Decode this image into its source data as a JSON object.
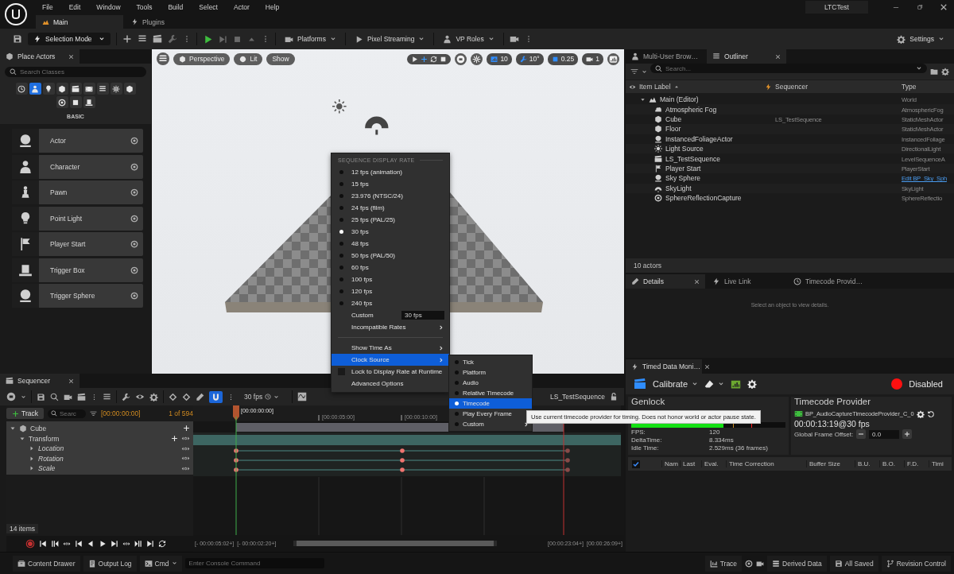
{
  "window": {
    "title": "LTCTest",
    "menu": [
      "File",
      "Edit",
      "Window",
      "Tools",
      "Build",
      "Select",
      "Actor",
      "Help"
    ],
    "tabs": [
      {
        "label": "Main",
        "selected": true
      },
      {
        "label": "Plugins",
        "selected": false
      }
    ]
  },
  "toolbar": {
    "mode": "Selection Mode",
    "dropdowns": [
      "Platforms",
      "Pixel Streaming",
      "VP Roles"
    ],
    "settings": "Settings"
  },
  "place_actors": {
    "title": "Place Actors",
    "search_placeholder": "Search Classes",
    "category_tabs": [
      {
        "selected": false
      },
      {
        "selected": true
      },
      {
        "selected": false
      },
      {
        "selected": false
      },
      {
        "selected": false
      },
      {
        "selected": false
      },
      {
        "selected": false
      },
      {
        "selected": false
      },
      {
        "selected": false
      },
      {
        "selected": false
      },
      {
        "selected": false
      },
      {
        "selected": false
      }
    ],
    "category": "BASIC",
    "items": [
      "Actor",
      "Character",
      "Pawn",
      "Point Light",
      "Player Start",
      "Trigger Box",
      "Trigger Sphere"
    ]
  },
  "viewport": {
    "buttons": [
      "Perspective",
      "Lit",
      "Show"
    ],
    "grid_snap": "10",
    "rotation_snap": "10°",
    "scale_snap": "0.25",
    "camera_speed": "1"
  },
  "display_rate_menu": {
    "header": "SEQUENCE DISPLAY RATE",
    "rates": [
      {
        "label": "12 fps (animation)",
        "selected": false
      },
      {
        "label": "15 fps",
        "selected": false
      },
      {
        "label": "23.976 (NTSC/24)",
        "selected": false
      },
      {
        "label": "24 fps (film)",
        "selected": false
      },
      {
        "label": "25 fps (PAL/25)",
        "selected": false
      },
      {
        "label": "30 fps",
        "selected": true
      },
      {
        "label": "48 fps",
        "selected": false
      },
      {
        "label": "50 fps (PAL/50)",
        "selected": false
      },
      {
        "label": "60 fps",
        "selected": false
      },
      {
        "label": "100 fps",
        "selected": false
      },
      {
        "label": "120 fps",
        "selected": false
      },
      {
        "label": "240 fps",
        "selected": false
      }
    ],
    "custom": {
      "label": "Custom",
      "value": "30 fps"
    },
    "incompatible": {
      "label": "Incompatible Rates",
      "highlighted": false
    },
    "options": [
      {
        "label": "Show Time As",
        "kind": "submenu",
        "highlighted": false
      },
      {
        "label": "Clock Source",
        "kind": "submenu",
        "highlighted": true
      },
      {
        "label": "Lock to Display Rate at Runtime",
        "kind": "checkbox",
        "checked": false,
        "highlighted": false
      },
      {
        "label": "Advanced Options",
        "kind": "plain",
        "highlighted": false
      }
    ]
  },
  "clock_source_menu": {
    "items": [
      {
        "label": "Tick",
        "selected": false,
        "submenu": false
      },
      {
        "label": "Platform",
        "selected": false,
        "submenu": false
      },
      {
        "label": "Audio",
        "selected": false,
        "submenu": false
      },
      {
        "label": "Relative Timecode",
        "selected": false,
        "submenu": false
      },
      {
        "label": "Timecode",
        "selected": true,
        "submenu": false
      },
      {
        "label": "Play Every Frame",
        "selected": false,
        "submenu": false
      },
      {
        "label": "Custom",
        "selected": false,
        "submenu": true
      }
    ]
  },
  "tooltip": {
    "text": "Use current timecode provider for timing. Does not honor world or actor pause state."
  },
  "outliner": {
    "tabs": [
      {
        "label": "Multi-User Brow…",
        "selected": false
      },
      {
        "label": "Outliner",
        "selected": true
      }
    ],
    "search_placeholder": "Search...",
    "columns": [
      "Item Label",
      "Sequencer",
      "Type"
    ],
    "tree": [
      {
        "label": "Main (Editor)",
        "type": "World",
        "expanded": true,
        "children": [
          {
            "label": "Atmospheric Fog",
            "type": "AtmosphericFog",
            "type_link": false
          },
          {
            "label": "Cube",
            "sequencer": "LS_TestSequence",
            "type": "StaticMeshActor",
            "type_link": false
          },
          {
            "label": "Floor",
            "type": "StaticMeshActor",
            "type_link": false
          },
          {
            "label": "InstancedFoliageActor",
            "type": "InstancedFoliage",
            "type_link": false
          },
          {
            "label": "Light Source",
            "type": "DirectionalLight",
            "type_link": false
          },
          {
            "label": "LS_TestSequence",
            "type": "LevelSequenceA",
            "type_link": false
          },
          {
            "label": "Player Start",
            "type": "PlayerStart",
            "type_link": false
          },
          {
            "label": "Sky Sphere",
            "type": "Edit BP_Sky_Sph",
            "type_link": true
          },
          {
            "label": "SkyLight",
            "type": "SkyLight",
            "type_link": false
          },
          {
            "label": "SphereReflectionCapture",
            "type": "SphereReflectio",
            "type_link": false
          }
        ]
      }
    ],
    "footer": "10 actors"
  },
  "details": {
    "tabs": [
      {
        "label": "Details",
        "selected": true
      },
      {
        "label": "Live Link",
        "selected": false
      },
      {
        "label": "Timecode Provid…",
        "selected": false
      }
    ],
    "message": "Select an object to view details."
  },
  "timed_data": {
    "tab": "Timed Data Moni…",
    "calibrate": "Calibrate",
    "status": "Disabled",
    "genlock": {
      "title": "Genlock",
      "level": 0.6,
      "stats": [
        {
          "label": "FPS:",
          "value": "120"
        },
        {
          "label": "DeltaTime:",
          "value": "8.334ms"
        },
        {
          "label": "Idle Time:",
          "value": "2.529ms (36 frames)"
        }
      ]
    },
    "timecode_provider": {
      "title": "Timecode Provider",
      "name": "BP_AudioCaptureTimecodeProvider_C_0",
      "timecode": "00:00:13:19@30 fps",
      "offset_label": "Global Frame Offset:",
      "offset_value": "0.0"
    },
    "table": {
      "all_checked": true,
      "columns": [
        "Nam",
        "Last",
        "Eval.",
        "Time Correction",
        "Buffer Size",
        "B.U.",
        "B.O.",
        "F.D.",
        "Timi"
      ]
    }
  },
  "sequencer": {
    "tab": "Sequencer",
    "snap_enabled": true,
    "frame_rate": "30 fps",
    "sequence_name": "LS_TestSequence",
    "add_track": "Track",
    "search_placeholder": "Searc",
    "current_time": "[00:00:00:00]",
    "key_count": "1 of 594",
    "tracks": [
      {
        "label": "Cube",
        "expanded": true,
        "children": [
          {
            "label": "Transform",
            "expanded": true,
            "children": [
              {
                "label": "Location",
                "expanded": false
              },
              {
                "label": "Rotation",
                "expanded": false
              },
              {
                "label": "Scale",
                "expanded": false
              }
            ]
          }
        ]
      }
    ],
    "item_count": "14 items",
    "playhead_label": "[00:00:00:00]",
    "ticks": [
      "[00:00:05:00]",
      "[00:00:10:00]"
    ],
    "range_labels": [
      "[- 00:00:05:02+]",
      "[- 00:00:02:20+]",
      "[00:00:23:04+]",
      "[00:00:26:09+]"
    ]
  },
  "status_bar": {
    "left": [
      "Content Drawer",
      "Output Log",
      "Cmd"
    ],
    "console_placeholder": "Enter Console Command",
    "right": [
      "Trace",
      "Derived Data",
      "All Saved",
      "Revision Control"
    ]
  }
}
